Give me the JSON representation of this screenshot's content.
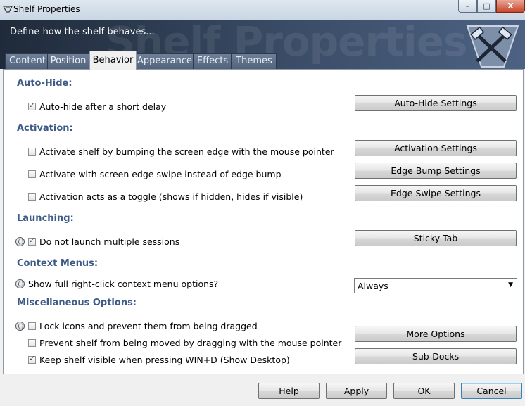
{
  "window": {
    "title": "Shelf Properties",
    "controls": {
      "minimize": "–",
      "maximize": "□",
      "close": "X"
    }
  },
  "banner": {
    "subtitle": "Define how the shelf behaves...",
    "watermark": "Shelf Properties",
    "logo": "hammer-logo-icon"
  },
  "tabs": [
    {
      "label": "Content",
      "active": false
    },
    {
      "label": "Position",
      "active": false
    },
    {
      "label": "Behavior",
      "active": true
    },
    {
      "label": "Appearance",
      "active": false
    },
    {
      "label": "Effects",
      "active": false
    },
    {
      "label": "Themes",
      "active": false
    }
  ],
  "sections": {
    "autohide": {
      "heading": "Auto-Hide:",
      "options": [
        {
          "label": "Auto-hide after a short delay",
          "checked": true
        }
      ],
      "button": "Auto-Hide Settings"
    },
    "activation": {
      "heading": "Activation:",
      "options": [
        {
          "label": "Activate shelf by bumping the screen edge with the mouse pointer",
          "checked": false
        },
        {
          "label": "Activate with screen edge swipe instead of edge bump",
          "checked": false
        },
        {
          "label": "Activation acts as a toggle (shows if hidden, hides if visible)",
          "checked": false
        }
      ],
      "buttons": [
        "Activation Settings",
        "Edge Bump Settings",
        "Edge Swipe Settings"
      ]
    },
    "launching": {
      "heading": "Launching:",
      "options": [
        {
          "label": "Do not launch multiple sessions",
          "checked": true
        }
      ],
      "button": "Sticky Tab"
    },
    "context": {
      "heading": "Context Menus:",
      "label": "Show full right-click context menu options?",
      "select_value": "Always"
    },
    "misc": {
      "heading": "Miscellaneous Options:",
      "options": [
        {
          "label": "Lock icons and prevent them from being dragged",
          "checked": false
        },
        {
          "label": "Prevent shelf from being moved by dragging with the mouse pointer",
          "checked": false
        },
        {
          "label": "Keep shelf visible when pressing WIN+D (Show Desktop)",
          "checked": true
        }
      ],
      "buttons": [
        "More Options",
        "Sub-Docks"
      ]
    }
  },
  "footer": {
    "help": "Help",
    "apply": "Apply",
    "ok": "OK",
    "cancel": "Cancel"
  },
  "colors": {
    "section_heading": "#3e5a86",
    "banner": "#2d3b52",
    "tab_inactive": "#5f6f88"
  }
}
